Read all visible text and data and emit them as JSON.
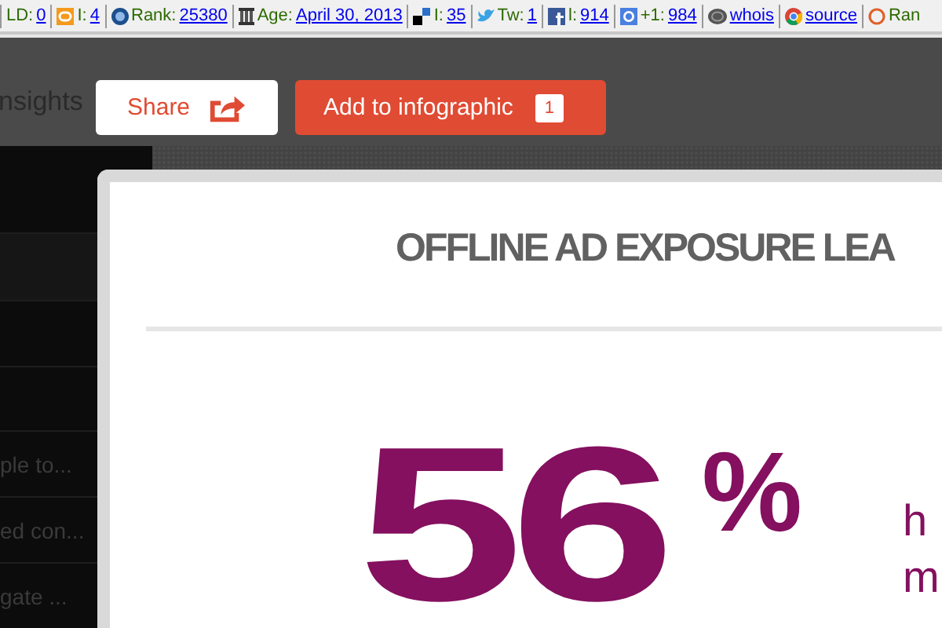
{
  "toolbar": {
    "items": [
      {
        "label": "LD:",
        "value": "0"
      },
      {
        "label": "I:",
        "value": "4"
      },
      {
        "label": "Rank:",
        "value": "25380"
      },
      {
        "label": "Age:",
        "value": "April 30, 2013"
      },
      {
        "label": "I:",
        "value": "35"
      },
      {
        "label": "Tw:",
        "value": "1"
      },
      {
        "label": "l:",
        "value": "914"
      },
      {
        "label": "+1:",
        "value": "984"
      },
      {
        "value": "whois"
      },
      {
        "value": "source"
      },
      {
        "label": "Ran"
      }
    ]
  },
  "header": {
    "title": "nsights",
    "buttons": [
      {
        "kind": "share",
        "label": "Share"
      },
      {
        "kind": "add",
        "label": "Add to infographic",
        "count": "1"
      }
    ]
  },
  "sidebar": {
    "items": [
      {
        "selected": true
      },
      {
        "selected": false
      },
      {
        "selected": false
      },
      {
        "label": "ple to...",
        "selected": false
      },
      {
        "label": "ed con...",
        "selected": false
      },
      {
        "label": "gate ...",
        "selected": false
      }
    ]
  },
  "card": {
    "title": "OFFLINE AD EXPOSURE LEA",
    "stat": "56",
    "stat_unit": "%",
    "stat_text": [
      "h",
      "m"
    ]
  }
}
